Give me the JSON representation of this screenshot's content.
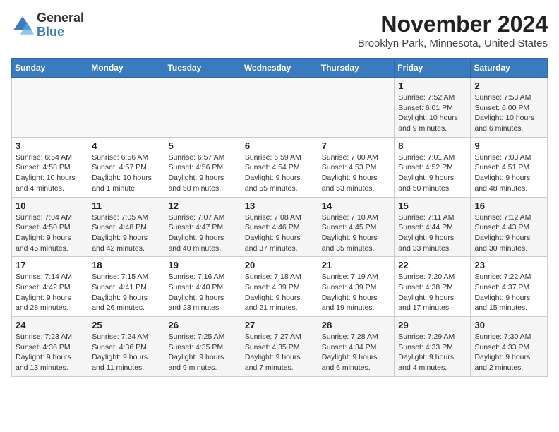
{
  "header": {
    "logo": {
      "general": "General",
      "blue": "Blue"
    },
    "title": "November 2024",
    "location": "Brooklyn Park, Minnesota, United States"
  },
  "weekdays": [
    "Sunday",
    "Monday",
    "Tuesday",
    "Wednesday",
    "Thursday",
    "Friday",
    "Saturday"
  ],
  "weeks": [
    [
      {
        "day": "",
        "info": ""
      },
      {
        "day": "",
        "info": ""
      },
      {
        "day": "",
        "info": ""
      },
      {
        "day": "",
        "info": ""
      },
      {
        "day": "",
        "info": ""
      },
      {
        "day": "1",
        "info": "Sunrise: 7:52 AM\nSunset: 6:01 PM\nDaylight: 10 hours and 9 minutes."
      },
      {
        "day": "2",
        "info": "Sunrise: 7:53 AM\nSunset: 6:00 PM\nDaylight: 10 hours and 6 minutes."
      }
    ],
    [
      {
        "day": "3",
        "info": "Sunrise: 6:54 AM\nSunset: 4:58 PM\nDaylight: 10 hours and 4 minutes."
      },
      {
        "day": "4",
        "info": "Sunrise: 6:56 AM\nSunset: 4:57 PM\nDaylight: 10 hours and 1 minute."
      },
      {
        "day": "5",
        "info": "Sunrise: 6:57 AM\nSunset: 4:56 PM\nDaylight: 9 hours and 58 minutes."
      },
      {
        "day": "6",
        "info": "Sunrise: 6:59 AM\nSunset: 4:54 PM\nDaylight: 9 hours and 55 minutes."
      },
      {
        "day": "7",
        "info": "Sunrise: 7:00 AM\nSunset: 4:53 PM\nDaylight: 9 hours and 53 minutes."
      },
      {
        "day": "8",
        "info": "Sunrise: 7:01 AM\nSunset: 4:52 PM\nDaylight: 9 hours and 50 minutes."
      },
      {
        "day": "9",
        "info": "Sunrise: 7:03 AM\nSunset: 4:51 PM\nDaylight: 9 hours and 48 minutes."
      }
    ],
    [
      {
        "day": "10",
        "info": "Sunrise: 7:04 AM\nSunset: 4:50 PM\nDaylight: 9 hours and 45 minutes."
      },
      {
        "day": "11",
        "info": "Sunrise: 7:05 AM\nSunset: 4:48 PM\nDaylight: 9 hours and 42 minutes."
      },
      {
        "day": "12",
        "info": "Sunrise: 7:07 AM\nSunset: 4:47 PM\nDaylight: 9 hours and 40 minutes."
      },
      {
        "day": "13",
        "info": "Sunrise: 7:08 AM\nSunset: 4:46 PM\nDaylight: 9 hours and 37 minutes."
      },
      {
        "day": "14",
        "info": "Sunrise: 7:10 AM\nSunset: 4:45 PM\nDaylight: 9 hours and 35 minutes."
      },
      {
        "day": "15",
        "info": "Sunrise: 7:11 AM\nSunset: 4:44 PM\nDaylight: 9 hours and 33 minutes."
      },
      {
        "day": "16",
        "info": "Sunrise: 7:12 AM\nSunset: 4:43 PM\nDaylight: 9 hours and 30 minutes."
      }
    ],
    [
      {
        "day": "17",
        "info": "Sunrise: 7:14 AM\nSunset: 4:42 PM\nDaylight: 9 hours and 28 minutes."
      },
      {
        "day": "18",
        "info": "Sunrise: 7:15 AM\nSunset: 4:41 PM\nDaylight: 9 hours and 26 minutes."
      },
      {
        "day": "19",
        "info": "Sunrise: 7:16 AM\nSunset: 4:40 PM\nDaylight: 9 hours and 23 minutes."
      },
      {
        "day": "20",
        "info": "Sunrise: 7:18 AM\nSunset: 4:39 PM\nDaylight: 9 hours and 21 minutes."
      },
      {
        "day": "21",
        "info": "Sunrise: 7:19 AM\nSunset: 4:39 PM\nDaylight: 9 hours and 19 minutes."
      },
      {
        "day": "22",
        "info": "Sunrise: 7:20 AM\nSunset: 4:38 PM\nDaylight: 9 hours and 17 minutes."
      },
      {
        "day": "23",
        "info": "Sunrise: 7:22 AM\nSunset: 4:37 PM\nDaylight: 9 hours and 15 minutes."
      }
    ],
    [
      {
        "day": "24",
        "info": "Sunrise: 7:23 AM\nSunset: 4:36 PM\nDaylight: 9 hours and 13 minutes."
      },
      {
        "day": "25",
        "info": "Sunrise: 7:24 AM\nSunset: 4:36 PM\nDaylight: 9 hours and 11 minutes."
      },
      {
        "day": "26",
        "info": "Sunrise: 7:25 AM\nSunset: 4:35 PM\nDaylight: 9 hours and 9 minutes."
      },
      {
        "day": "27",
        "info": "Sunrise: 7:27 AM\nSunset: 4:35 PM\nDaylight: 9 hours and 7 minutes."
      },
      {
        "day": "28",
        "info": "Sunrise: 7:28 AM\nSunset: 4:34 PM\nDaylight: 9 hours and 6 minutes."
      },
      {
        "day": "29",
        "info": "Sunrise: 7:29 AM\nSunset: 4:33 PM\nDaylight: 9 hours and 4 minutes."
      },
      {
        "day": "30",
        "info": "Sunrise: 7:30 AM\nSunset: 4:33 PM\nDaylight: 9 hours and 2 minutes."
      }
    ]
  ]
}
